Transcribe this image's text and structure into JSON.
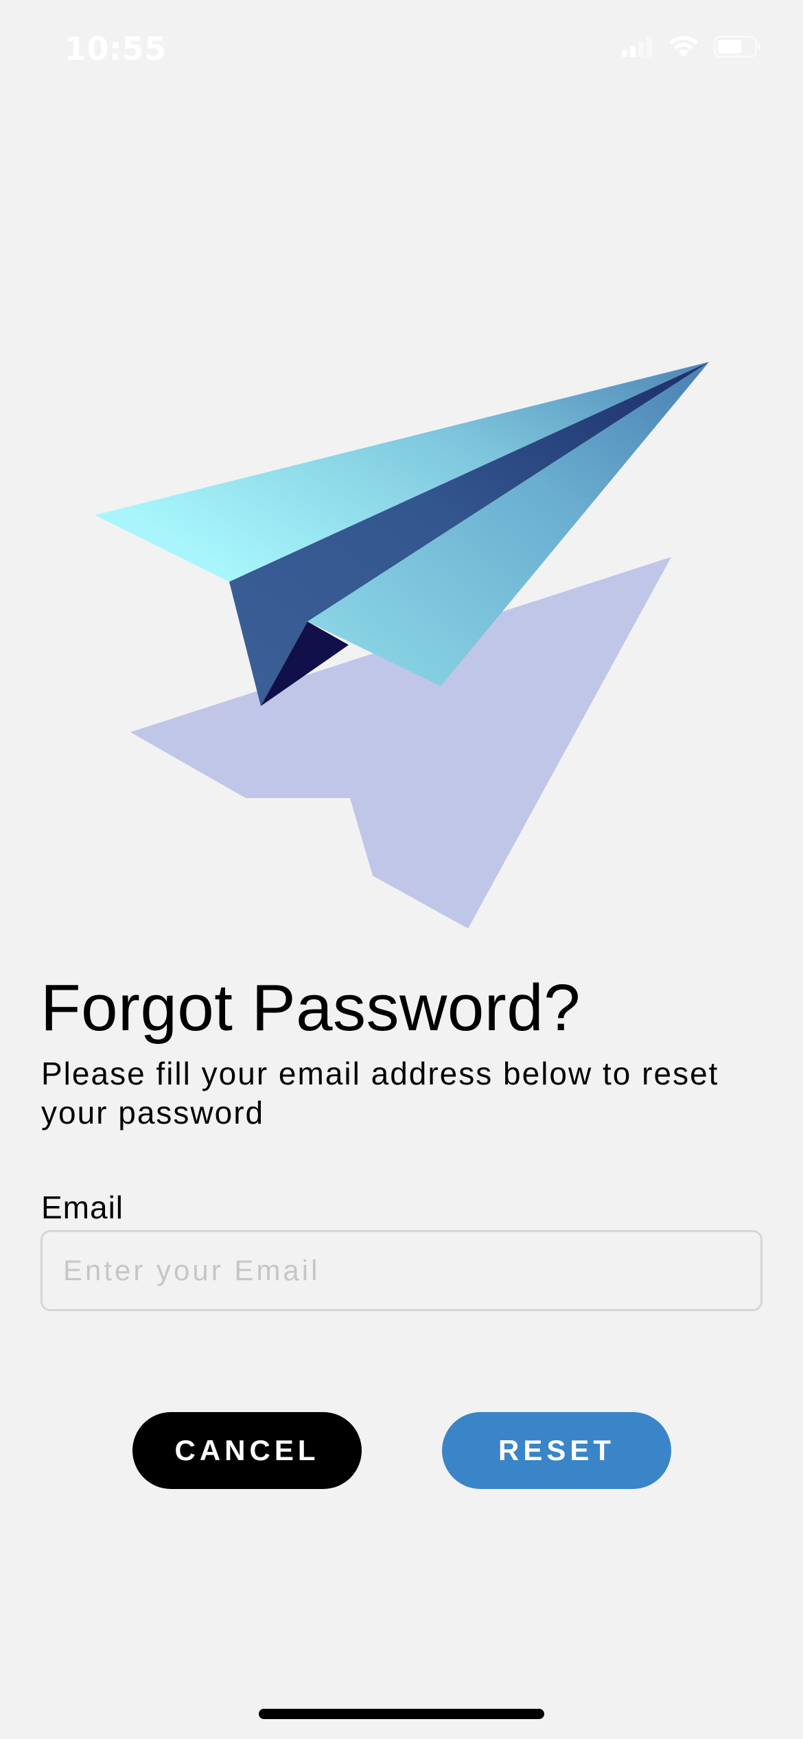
{
  "status_bar": {
    "time": "10:55",
    "icons": [
      "cellular-signal-icon",
      "wifi-icon",
      "battery-icon"
    ]
  },
  "illustration": {
    "name": "paper-plane-illustration",
    "colors": {
      "plane_light": "#a8f6fc",
      "plane_mid": "#6fbfda",
      "plane_dark": "#3b5f96",
      "plane_fold": "#12104a",
      "shadow": "#bfc6e8"
    }
  },
  "form": {
    "title": "Forgot Password?",
    "subtitle": "Please fill your email address below to reset your password",
    "email_label": "Email",
    "email_placeholder": "Enter your Email",
    "email_value": ""
  },
  "buttons": {
    "cancel_label": "CANCEL",
    "reset_label": "RESET"
  },
  "colors": {
    "background": "#f2f2f2",
    "cancel_button": "#000000",
    "reset_button": "#3a84c8",
    "input_border": "#d6d6d6"
  }
}
